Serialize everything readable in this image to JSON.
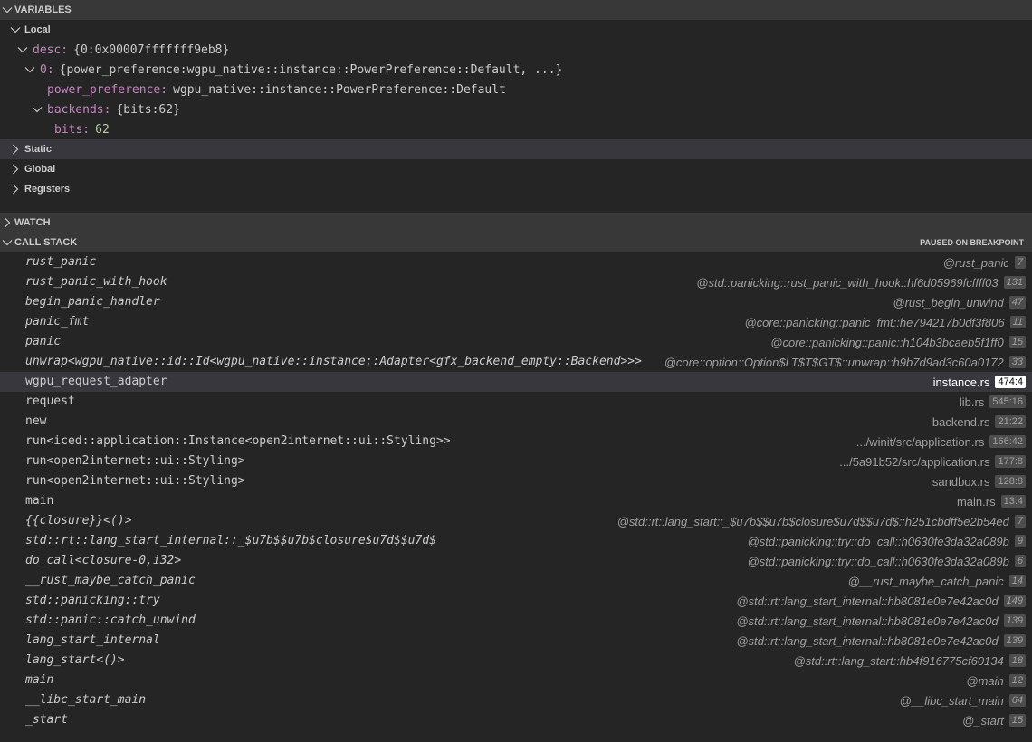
{
  "variables": {
    "header": "VARIABLES",
    "local_label": "Local",
    "desc": {
      "name": "desc:",
      "value": "{0:0x00007fffffff9eb8}"
    },
    "item0": {
      "name": "0:",
      "value": "{power_preference:wgpu_native::instance::PowerPreference::Default, ...}"
    },
    "power_preference": {
      "name": "power_preference:",
      "value": "wgpu_native::instance::PowerPreference::Default"
    },
    "backends": {
      "name": "backends:",
      "value": "{bits:62}"
    },
    "bits": {
      "name": "bits:",
      "value": "62"
    },
    "static_label": "Static",
    "global_label": "Global",
    "registers_label": "Registers"
  },
  "watch": {
    "header": "WATCH"
  },
  "call_stack": {
    "header": "CALL STACK",
    "status": "PAUSED ON BREAKPOINT",
    "frames": [
      {
        "name": "rust_panic",
        "file": "@rust_panic",
        "line": "7",
        "italic": true
      },
      {
        "name": "rust_panic_with_hook",
        "file": "@std::panicking::rust_panic_with_hook::hf6d05969fcffff03",
        "line": "131",
        "italic": true
      },
      {
        "name": "begin_panic_handler",
        "file": "@rust_begin_unwind",
        "line": "47",
        "italic": true
      },
      {
        "name": "panic_fmt",
        "file": "@core::panicking::panic_fmt::he794217b0df3f806",
        "line": "11",
        "italic": true
      },
      {
        "name": "panic",
        "file": "@core::panicking::panic::h104b3bcaeb5f1ff0",
        "line": "15",
        "italic": true
      },
      {
        "name": "unwrap<wgpu_native::id::Id<wgpu_native::instance::Adapter<gfx_backend_empty::Backend>>>",
        "file": "@core::option::Option$LT$T$GT$::unwrap::h9b7d9ad3c60a0172",
        "line": "33",
        "italic": true
      },
      {
        "name": "wgpu_request_adapter",
        "file": "instance.rs",
        "line": "474:4",
        "italic": false,
        "selected": true
      },
      {
        "name": "request",
        "file": "lib.rs",
        "line": "545:16",
        "italic": false
      },
      {
        "name": "new",
        "file": "backend.rs",
        "line": "21:22",
        "italic": false
      },
      {
        "name": "run<iced::application::Instance<open2internet::ui::Styling>>",
        "file": ".../winit/src/application.rs",
        "line": "166:42",
        "italic": false
      },
      {
        "name": "run<open2internet::ui::Styling>",
        "file": ".../5a91b52/src/application.rs",
        "line": "177:8",
        "italic": false
      },
      {
        "name": "run<open2internet::ui::Styling>",
        "file": "sandbox.rs",
        "line": "128:8",
        "italic": false
      },
      {
        "name": "main",
        "file": "main.rs",
        "line": "13:4",
        "italic": false
      },
      {
        "name": "{{closure}}<()>",
        "file": "@std::rt::lang_start::_$u7b$$u7b$closure$u7d$$u7d$::h251cbdff5e2b54ed",
        "line": "7",
        "italic": true
      },
      {
        "name": "std::rt::lang_start_internal::_$u7b$$u7b$closure$u7d$$u7d$",
        "file": "@std::panicking::try::do_call::h0630fe3da32a089b",
        "line": "9",
        "italic": true
      },
      {
        "name": "do_call<closure-0,i32>",
        "file": "@std::panicking::try::do_call::h0630fe3da32a089b",
        "line": "6",
        "italic": true
      },
      {
        "name": "__rust_maybe_catch_panic",
        "file": "@__rust_maybe_catch_panic",
        "line": "14",
        "italic": true
      },
      {
        "name": "std::panicking::try",
        "file": "@std::rt::lang_start_internal::hb8081e0e7e42ac0d",
        "line": "149",
        "italic": true
      },
      {
        "name": "std::panic::catch_unwind",
        "file": "@std::rt::lang_start_internal::hb8081e0e7e42ac0d",
        "line": "139",
        "italic": true
      },
      {
        "name": "lang_start_internal",
        "file": "@std::rt::lang_start_internal::hb8081e0e7e42ac0d",
        "line": "139",
        "italic": true
      },
      {
        "name": "lang_start<()>",
        "file": "@std::rt::lang_start::hb4f916775cf60134",
        "line": "18",
        "italic": true
      },
      {
        "name": "main",
        "file": "@main",
        "line": "12",
        "italic": true
      },
      {
        "name": "__libc_start_main",
        "file": "@__libc_start_main",
        "line": "64",
        "italic": true
      },
      {
        "name": "_start",
        "file": "@_start",
        "line": "15",
        "italic": true
      }
    ]
  },
  "colors": {
    "background": "#252526",
    "header": "#383838",
    "selection": "#37373d",
    "var_name": "#c586c0",
    "number": "#b5cea8"
  }
}
